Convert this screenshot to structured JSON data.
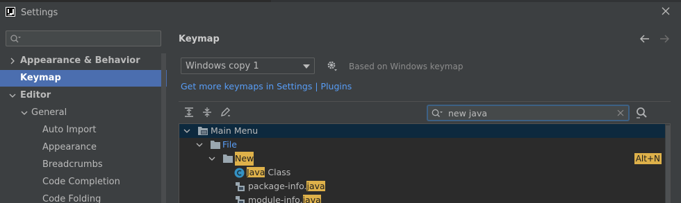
{
  "window": {
    "title": "Settings",
    "app_icon": "intellij-icon",
    "close_icon": "close-icon"
  },
  "sidebar": {
    "search_value": "",
    "items": [
      {
        "label": "Appearance & Behavior",
        "level": 0,
        "expandable": true,
        "expanded": false,
        "bold": true
      },
      {
        "label": "Keymap",
        "level": 0,
        "expandable": false,
        "bold": true,
        "selected": true
      },
      {
        "label": "Editor",
        "level": 0,
        "expandable": true,
        "expanded": true,
        "bold": true
      },
      {
        "label": "General",
        "level": 1,
        "expandable": true,
        "expanded": true
      },
      {
        "label": "Auto Import",
        "level": 2
      },
      {
        "label": "Appearance",
        "level": 2
      },
      {
        "label": "Breadcrumbs",
        "level": 2
      },
      {
        "label": "Code Completion",
        "level": 2
      },
      {
        "label": "Code Folding",
        "level": 2
      }
    ]
  },
  "main": {
    "title": "Keymap",
    "keymap_select": {
      "value": "Windows copy 1"
    },
    "based_on": "Based on Windows keymap",
    "get_more_link": "Get more keymaps in Settings | Plugins",
    "filter": {
      "value": "new java"
    },
    "tree": [
      {
        "label": "Main Menu",
        "level": 0,
        "icon": "menu-icon",
        "expanded": true,
        "selected": true
      },
      {
        "label": "File",
        "level": 1,
        "icon": "folder-icon",
        "expanded": true,
        "color": "blue"
      },
      {
        "label": "New",
        "level": 2,
        "icon": "folder-icon",
        "expanded": true,
        "highlight": "New",
        "shortcut": "Alt+N"
      },
      {
        "pre": "",
        "hl": "Java",
        "post": " Class",
        "level": 3,
        "icon": "java-class-icon"
      },
      {
        "pre": "package-info.",
        "hl": "java",
        "post": "",
        "level": 3,
        "icon": "package-info-icon"
      },
      {
        "pre": "module-info.",
        "hl": "java",
        "post": "",
        "level": 3,
        "icon": "module-info-icon"
      }
    ]
  },
  "colors": {
    "selection": "#4b6eaf",
    "link": "#589df6",
    "highlight": "#deb14a",
    "background": "#3c3f41",
    "tree_background": "#2b2b2b"
  }
}
